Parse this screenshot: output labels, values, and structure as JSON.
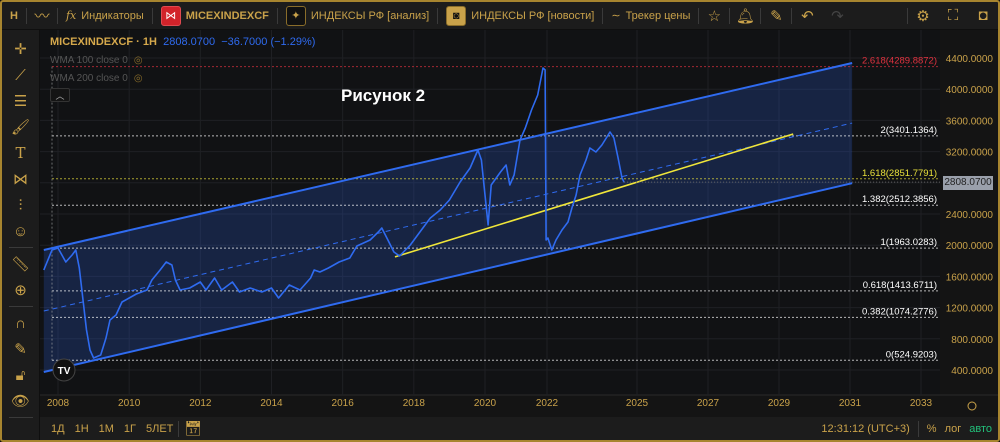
{
  "topbar": {
    "interval": "H",
    "indicators": "Индикаторы",
    "symbol": "MICEXINDEXCF",
    "analysis": "ИНДЕКСЫ РФ [анализ]",
    "news": "ИНДЕКСЫ РФ [новости]",
    "tracker": "Трекер цены"
  },
  "legend": {
    "symbol": "MICEXINDEXCF · 1H",
    "price": "2808.0700",
    "change": "−36.7000 (−1.29%)",
    "indicators": [
      "WMA 100 close 0",
      "WMA 200 close 0"
    ]
  },
  "annotation": "Рисунок 2",
  "last_price_tag": "2808.0700",
  "bottombar": {
    "ranges": [
      "1Д",
      "1Н",
      "1М",
      "1Г",
      "5ЛЕТ"
    ],
    "time": "12:31:12 (UTC+3)",
    "percent": "%",
    "log": "лог",
    "auto": "авто"
  },
  "colors": {
    "line": "#2f6bf0",
    "accent": "#c9a24a",
    "fib_top": "#e0323f",
    "fib_1618": "#e8e03a",
    "trend": "#f0e63a",
    "auto": "#22c07a"
  },
  "chart_data": {
    "type": "line",
    "title": "MICEXINDEXCF · 1H",
    "ylim": [
      400,
      4400
    ],
    "y_ticks": [
      400,
      800,
      1200,
      1600,
      2000,
      2400,
      2800,
      3200,
      3600,
      4000,
      4400
    ],
    "y_tick_labels": [
      "400.0000",
      "800.0000",
      "1200.0000",
      "1600.0000",
      "2000.0000",
      "2400.0000",
      "2800.0000",
      "3200.0000",
      "3600.0000",
      "4000.0000",
      "4400.0000"
    ],
    "x_ticks": [
      "2008",
      "2010",
      "2012",
      "2014",
      "2016",
      "2018",
      "2020",
      "2022",
      "2025",
      "2027",
      "2029",
      "2031",
      "2033"
    ],
    "series": [
      {
        "name": "MICEXINDEXCF",
        "points": [
          [
            2007.6,
            1682
          ],
          [
            2007.83,
            1938
          ],
          [
            2008.0,
            1964
          ],
          [
            2008.22,
            1785
          ],
          [
            2008.4,
            1875
          ],
          [
            2008.5,
            1938
          ],
          [
            2008.6,
            1708
          ],
          [
            2008.8,
            913
          ],
          [
            2008.9,
            657
          ],
          [
            2009.0,
            554
          ],
          [
            2009.2,
            592
          ],
          [
            2009.35,
            810
          ],
          [
            2009.46,
            1041
          ],
          [
            2009.63,
            1105
          ],
          [
            2009.8,
            1272
          ],
          [
            2010.0,
            1323
          ],
          [
            2010.2,
            1374
          ],
          [
            2010.5,
            1426
          ],
          [
            2010.64,
            1554
          ],
          [
            2010.87,
            1682
          ],
          [
            2011.04,
            1785
          ],
          [
            2011.2,
            1746
          ],
          [
            2011.3,
            1554
          ],
          [
            2011.43,
            1426
          ],
          [
            2011.7,
            1451
          ],
          [
            2012.0,
            1528
          ],
          [
            2012.16,
            1426
          ],
          [
            2012.4,
            1579
          ],
          [
            2012.6,
            1426
          ],
          [
            2012.9,
            1528
          ],
          [
            2013.1,
            1400
          ],
          [
            2013.4,
            1451
          ],
          [
            2013.73,
            1400
          ],
          [
            2014.0,
            1451
          ],
          [
            2014.2,
            1323
          ],
          [
            2014.5,
            1490
          ],
          [
            2014.8,
            1426
          ],
          [
            2015.1,
            1579
          ],
          [
            2015.2,
            1682
          ],
          [
            2015.36,
            1656
          ],
          [
            2015.6,
            1708
          ],
          [
            2015.9,
            1785
          ],
          [
            2016.2,
            1836
          ],
          [
            2016.4,
            1990
          ],
          [
            2016.77,
            2067
          ],
          [
            2017.0,
            2169
          ],
          [
            2017.1,
            2220
          ],
          [
            2017.27,
            2067
          ],
          [
            2017.44,
            1913
          ],
          [
            2017.6,
            1862
          ],
          [
            2017.9,
            2003
          ],
          [
            2018.17,
            2169
          ],
          [
            2018.46,
            2348
          ],
          [
            2018.74,
            2451
          ],
          [
            2019.0,
            2579
          ],
          [
            2019.3,
            2810
          ],
          [
            2019.58,
            2990
          ],
          [
            2019.8,
            3220
          ],
          [
            2019.9,
            3092
          ],
          [
            2020.1,
            2259
          ],
          [
            2020.2,
            2772
          ],
          [
            2020.5,
            2938
          ],
          [
            2020.68,
            3028
          ],
          [
            2020.8,
            2772
          ],
          [
            2020.94,
            2900
          ],
          [
            2021.13,
            3348
          ],
          [
            2021.3,
            3503
          ],
          [
            2021.5,
            3733
          ],
          [
            2021.7,
            3926
          ],
          [
            2021.87,
            4272
          ],
          [
            2021.94,
            4247
          ],
          [
            2021.97,
            2067
          ],
          [
            2022.03,
            2092
          ],
          [
            2022.16,
            1938
          ],
          [
            2022.3,
            2067
          ],
          [
            2022.5,
            2195
          ],
          [
            2022.7,
            2297
          ],
          [
            2022.83,
            2477
          ],
          [
            2022.97,
            2643
          ],
          [
            2023.1,
            2900
          ],
          [
            2023.3,
            3092
          ],
          [
            2023.43,
            3246
          ],
          [
            2023.63,
            3195
          ],
          [
            2023.83,
            3284
          ],
          [
            2024.1,
            3451
          ],
          [
            2024.23,
            3374
          ],
          [
            2024.37,
            3117
          ],
          [
            2024.5,
            2861
          ],
          [
            2024.57,
            2808
          ]
        ]
      }
    ],
    "fib_levels": [
      {
        "label": "2.618(4289.8872)",
        "value": 4289.8872,
        "color": "#e0323f"
      },
      {
        "label": "2(3401.1364)",
        "value": 3401.1364,
        "color": "#ffffff"
      },
      {
        "label": "1.618(2851.7791)",
        "value": 2851.7791,
        "color": "#e8e03a"
      },
      {
        "label": "1.382(2512.3856)",
        "value": 2512.3856,
        "color": "#ffffff"
      },
      {
        "label": "1(1963.0283)",
        "value": 1963.0283,
        "color": "#ffffff"
      },
      {
        "label": "0.618(1413.6711)",
        "value": 1413.6711,
        "color": "#ffffff"
      },
      {
        "label": "0.382(1074.2776)",
        "value": 1074.2776,
        "color": "#ffffff"
      },
      {
        "label": "0(524.9203)",
        "value": 524.9203,
        "color": "#ffffff"
      }
    ],
    "channel": {
      "upper": [
        [
          2007.6,
          1938
        ],
        [
          2031.06,
          4336
        ]
      ],
      "middle": [
        [
          2007.6,
          1156
        ],
        [
          2031.06,
          3566
        ]
      ],
      "lower": [
        [
          2007.6,
          374
        ],
        [
          2031.06,
          2795
        ]
      ]
    },
    "trendline": [
      [
        2017.47,
        1850
      ],
      [
        2029.4,
        3426
      ]
    ]
  }
}
